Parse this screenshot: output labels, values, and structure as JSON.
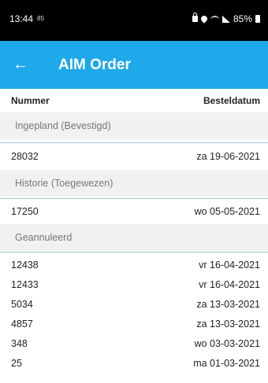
{
  "status_bar": {
    "time": "13:44",
    "sub": "85",
    "battery": "85%"
  },
  "app_bar": {
    "title": "AIM Order",
    "back_glyph": "←",
    "back_icon": "arrow-left-icon"
  },
  "columns": {
    "left": "Nummer",
    "right": "Besteldatum"
  },
  "sections": [
    {
      "title": "Ingepland (Bevestigd)",
      "rows": [
        {
          "number": "28032",
          "date": "za 19-06-2021"
        }
      ]
    },
    {
      "title": "Historie (Toegewezen)",
      "rows": [
        {
          "number": "17250",
          "date": "wo 05-05-2021"
        }
      ]
    },
    {
      "title": "Geannuleerd",
      "rows": [
        {
          "number": "12438",
          "date": "vr 16-04-2021"
        },
        {
          "number": "12433",
          "date": "vr 16-04-2021"
        },
        {
          "number": "5034",
          "date": "za 13-03-2021"
        },
        {
          "number": "4857",
          "date": "za 13-03-2021"
        },
        {
          "number": "348",
          "date": "wo 03-03-2021"
        },
        {
          "number": "25",
          "date": "ma 01-03-2021"
        }
      ]
    }
  ],
  "colors": {
    "app_bar": "#1fa8ea",
    "status_bar": "#000000",
    "section_bg": "#f1f1f1",
    "divider": "#9ec6cc"
  }
}
